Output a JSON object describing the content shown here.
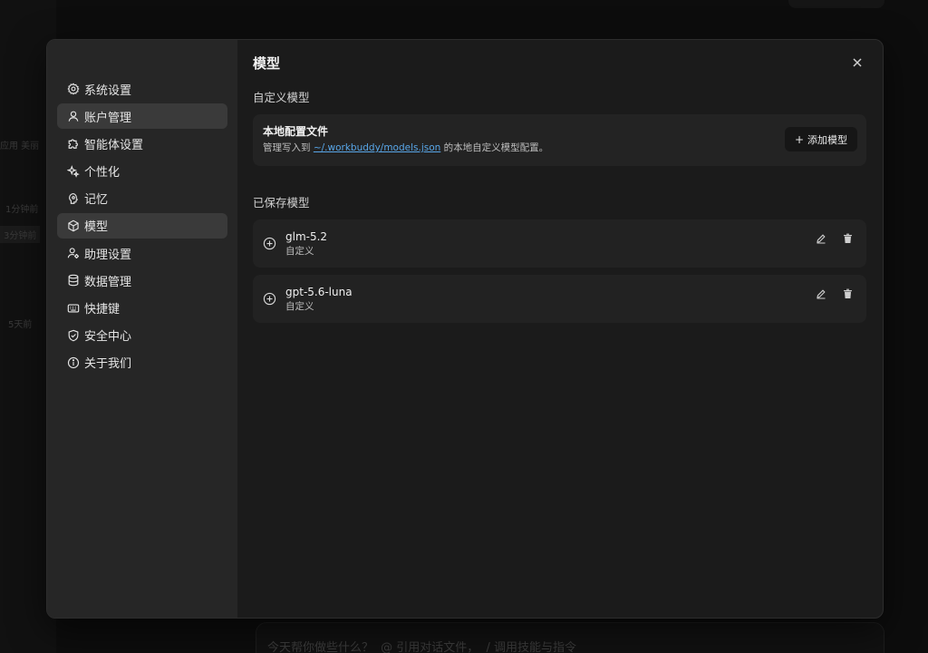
{
  "background": {
    "side_labels": [
      "应用 美丽",
      "1分钟前",
      "3分钟前",
      "5天前"
    ],
    "composer": {
      "prompt": "今天帮你做些什么？",
      "mention_hint": "@ 引用对话文件，",
      "slash_hint": "/ 调用技能与指令"
    }
  },
  "nav": {
    "items": [
      {
        "label": "系统设置",
        "icon": "gear-icon"
      },
      {
        "label": "账户管理",
        "icon": "user-icon"
      },
      {
        "label": "智能体设置",
        "icon": "puzzle-icon"
      },
      {
        "label": "个性化",
        "icon": "sparkle-icon"
      },
      {
        "label": "记忆",
        "icon": "memory-icon"
      },
      {
        "label": "模型",
        "icon": "cube-icon"
      },
      {
        "label": "助理设置",
        "icon": "assistant-icon"
      },
      {
        "label": "数据管理",
        "icon": "database-icon"
      },
      {
        "label": "快捷键",
        "icon": "keyboard-icon"
      },
      {
        "label": "安全中心",
        "icon": "shield-icon"
      },
      {
        "label": "关于我们",
        "icon": "info-icon"
      }
    ],
    "hovered_index": 1,
    "active_index": 5
  },
  "content": {
    "title": "模型",
    "custom_section_title": "自定义模型",
    "local_config": {
      "title": "本地配置文件",
      "desc_prefix": "管理写入到 ",
      "path": "~/.workbuddy/models.json",
      "desc_suffix": " 的本地自定义模型配置。",
      "add_button": "添加模型"
    },
    "saved_section_title": "已保存模型",
    "models": [
      {
        "name": "glm-5.2",
        "type": "自定义"
      },
      {
        "name": "gpt-5.6-luna",
        "type": "自定义"
      }
    ]
  },
  "colors": {
    "accent_link": "#58a6e8",
    "modal_bg": "#1b1b1b",
    "nav_bg": "#262626",
    "card_bg": "#232323"
  }
}
